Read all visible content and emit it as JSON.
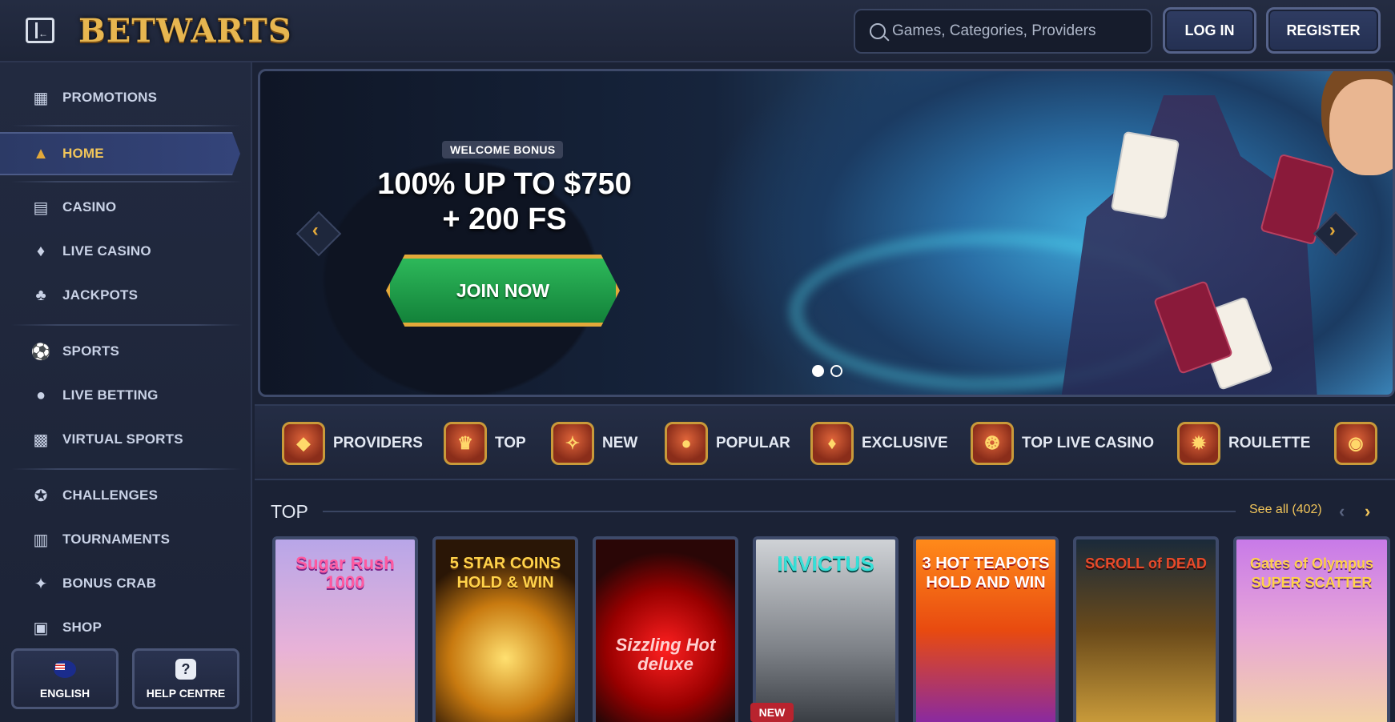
{
  "header": {
    "logo_text": "BETWARTS",
    "search_placeholder": "Games, Categories, Providers",
    "login_label": "LOG IN",
    "register_label": "REGISTER"
  },
  "sidebar": {
    "items": [
      {
        "label": "PROMOTIONS",
        "icon": "promotions-icon"
      },
      {
        "label": "HOME",
        "icon": "wizard-hat-icon"
      },
      {
        "label": "CASINO",
        "icon": "casino-icon"
      },
      {
        "label": "LIVE CASINO",
        "icon": "live-casino-icon"
      },
      {
        "label": "JACKPOTS",
        "icon": "clover-icon"
      },
      {
        "label": "SPORTS",
        "icon": "soccer-ball-icon"
      },
      {
        "label": "LIVE BETTING",
        "icon": "live-betting-icon"
      },
      {
        "label": "VIRTUAL SPORTS",
        "icon": "gamepad-icon"
      },
      {
        "label": "CHALLENGES",
        "icon": "badge-icon"
      },
      {
        "label": "TOURNAMENTS",
        "icon": "podium-icon"
      },
      {
        "label": "BONUS CRAB",
        "icon": "claw-icon"
      },
      {
        "label": "SHOP",
        "icon": "shopping-bag-icon"
      }
    ],
    "language_label": "ENGLISH",
    "help_label": "HELP CENTRE"
  },
  "hero": {
    "tag": "WELCOME BONUS",
    "title_line1": "100% UP TO $750",
    "title_line2": "+ 200 FS",
    "cta": "JOIN NOW"
  },
  "categories": [
    {
      "label": "PROVIDERS"
    },
    {
      "label": "TOP"
    },
    {
      "label": "NEW"
    },
    {
      "label": "POPULAR"
    },
    {
      "label": "EXCLUSIVE"
    },
    {
      "label": "TOP LIVE CASINO"
    },
    {
      "label": "ROULETTE"
    }
  ],
  "top_section": {
    "title": "TOP",
    "see_all": "See all (402)",
    "games": [
      {
        "title": "Sugar Rush 1000"
      },
      {
        "title": "5 STAR COINS HOLD & WIN"
      },
      {
        "title": "Sizzling Hot deluxe"
      },
      {
        "title": "INVICTUS"
      },
      {
        "title": "3 HOT TEAPOTS HOLD AND WIN"
      },
      {
        "title": "SCROLL of DEAD"
      },
      {
        "title": "Gates of Olympus SUPER SCATTER"
      }
    ],
    "new_badge": "NEW"
  },
  "colors": {
    "accent_gold": "#f0c45a",
    "background": "#1b2235",
    "cta_green": "#2db85a"
  }
}
